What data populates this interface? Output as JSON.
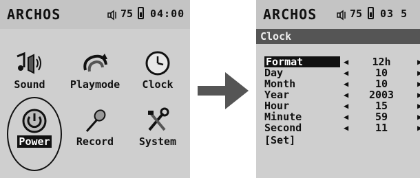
{
  "left_screen": {
    "brand": "ARCHOS",
    "volume": "75",
    "time": "04:00",
    "apps": [
      {
        "label": "Sound",
        "icon": "music-speaker-icon"
      },
      {
        "label": "Playmode",
        "icon": "playmode-icon"
      },
      {
        "label": "Clock",
        "icon": "clock-icon"
      },
      {
        "label": "Power",
        "icon": "power-icon"
      },
      {
        "label": "Record",
        "icon": "microphone-icon"
      },
      {
        "label": "System",
        "icon": "tools-icon"
      }
    ],
    "selected_app": "Power"
  },
  "right_screen": {
    "brand": "ARCHOS",
    "volume": "75",
    "time": "03 5",
    "title": "Clock",
    "settings": [
      {
        "label": "Format",
        "value": "12h"
      },
      {
        "label": "Day",
        "value": "10"
      },
      {
        "label": "Month",
        "value": "10"
      },
      {
        "label": "Year",
        "value": "2003"
      },
      {
        "label": "Hour",
        "value": "15"
      },
      {
        "label": "Minute",
        "value": "59"
      },
      {
        "label": "Second",
        "value": "11"
      }
    ],
    "set_label": "[Set]",
    "selected_setting": "Format"
  },
  "colors": {
    "screen_bg": "#cfcfcf",
    "statusbar_bg": "#c4c4c4",
    "title_bg": "#555555",
    "arrow": "#555555"
  }
}
